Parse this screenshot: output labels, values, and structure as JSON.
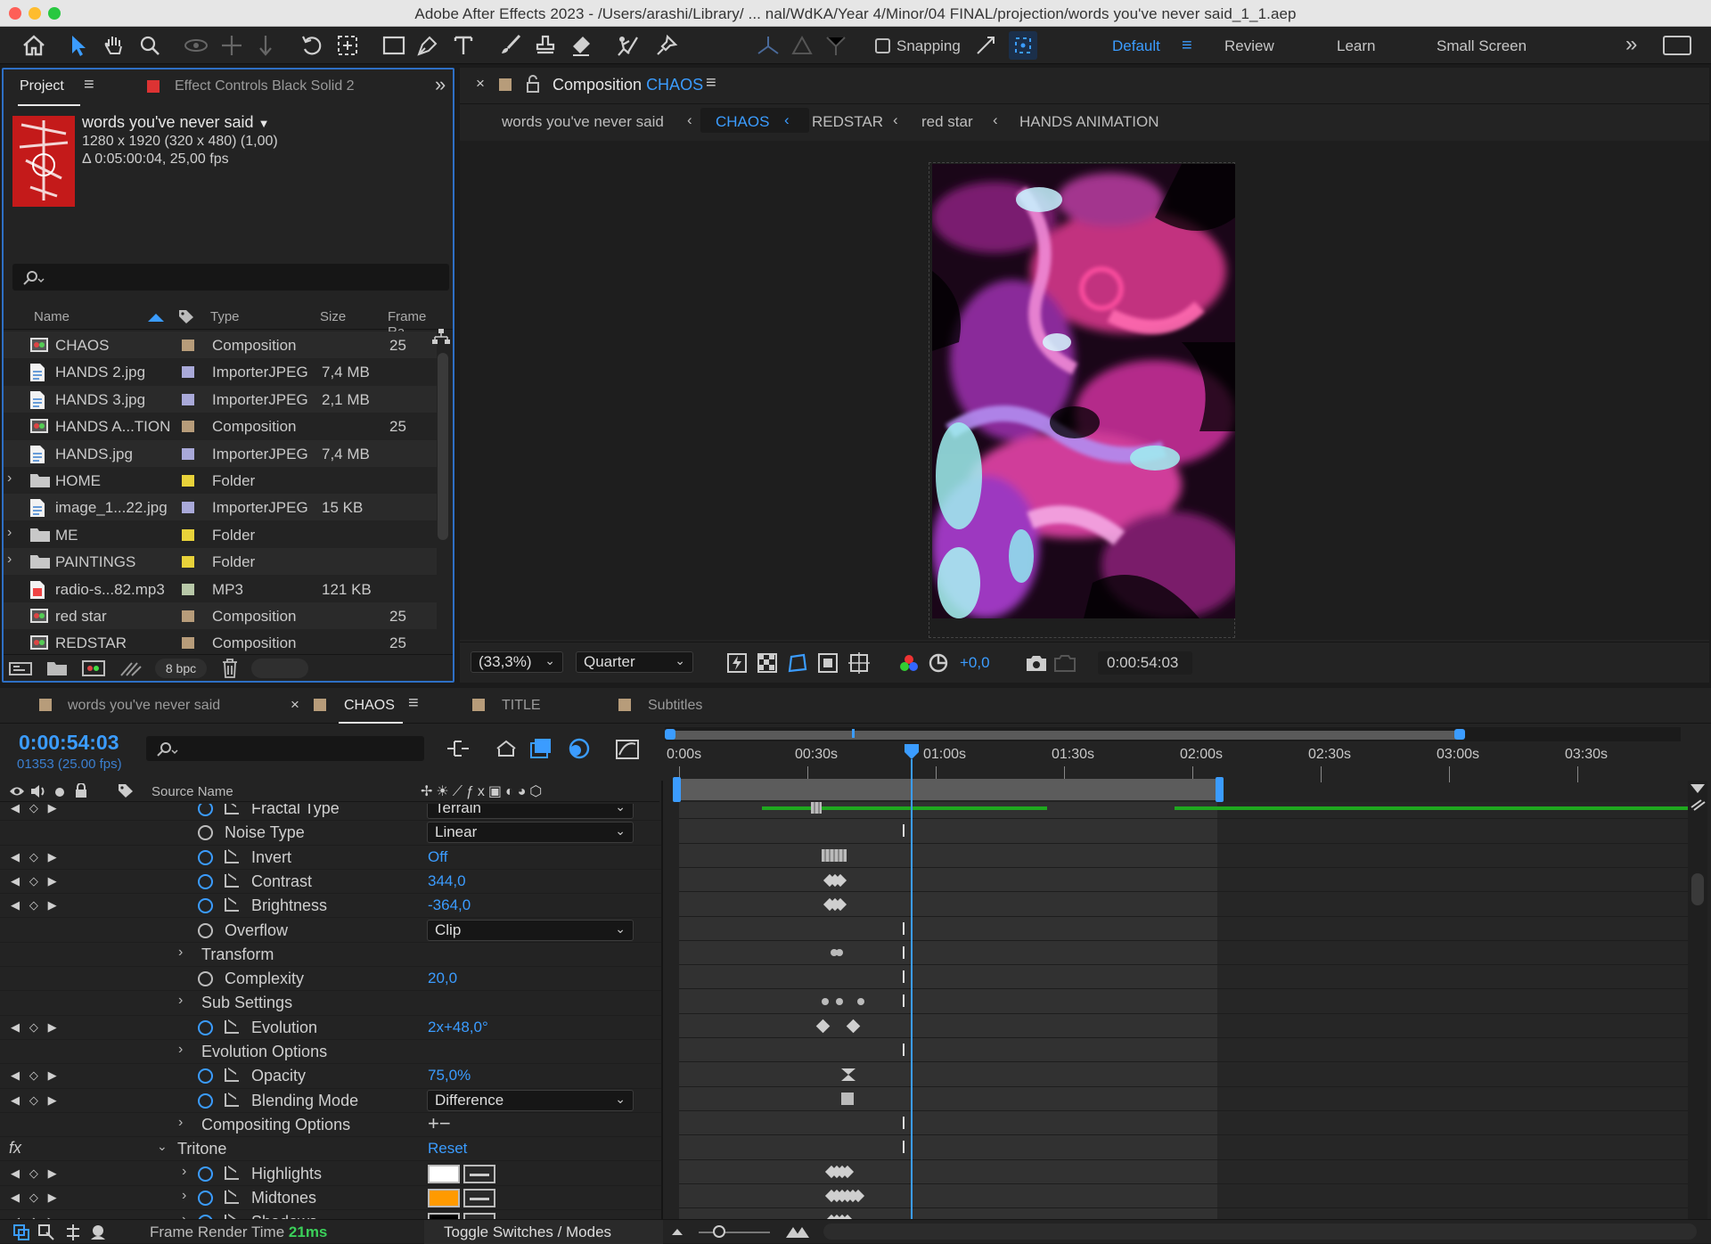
{
  "window": {
    "title": "Adobe After Effects 2023 - /Users/arashi/Library/ ... nal/WdKA/Year 4/Minor/04 FINAL/projection/words you've never said_1_1.aep"
  },
  "toolbar": {
    "snapping_label": "Snapping",
    "workspaces": [
      "Default",
      "Review",
      "Learn",
      "Small Screen"
    ]
  },
  "project_panel": {
    "tabs": [
      "Project",
      "Effect Controls Black Solid 2"
    ],
    "item_name": "words you've never said",
    "item_dims": "1280 x 1920  (320 x 480) (1,00)",
    "item_duration": "Δ 0:05:00:04, 25,00 fps",
    "columns": [
      "Name",
      "Type",
      "Size",
      "Frame Ra..."
    ],
    "items": [
      {
        "name": "CHAOS",
        "type": "Composition",
        "size": "",
        "fps": "25",
        "kind": "comp"
      },
      {
        "name": "HANDS 2.jpg",
        "type": "ImporterJPEG",
        "size": "7,4 MB",
        "fps": "",
        "kind": "file"
      },
      {
        "name": "HANDS 3.jpg",
        "type": "ImporterJPEG",
        "size": "2,1 MB",
        "fps": "",
        "kind": "file"
      },
      {
        "name": "HANDS A...TION",
        "type": "Composition",
        "size": "",
        "fps": "25",
        "kind": "comp"
      },
      {
        "name": "HANDS.jpg",
        "type": "ImporterJPEG",
        "size": "7,4 MB",
        "fps": "",
        "kind": "file"
      },
      {
        "name": "HOME",
        "type": "Folder",
        "size": "",
        "fps": "",
        "kind": "folder"
      },
      {
        "name": "image_1...22.jpg",
        "type": "ImporterJPEG",
        "size": "15 KB",
        "fps": "",
        "kind": "file"
      },
      {
        "name": "ME",
        "type": "Folder",
        "size": "",
        "fps": "",
        "kind": "folder"
      },
      {
        "name": "PAINTINGS",
        "type": "Folder",
        "size": "",
        "fps": "",
        "kind": "folder"
      },
      {
        "name": "radio-s...82.mp3",
        "type": "MP3",
        "size": "121 KB",
        "fps": "",
        "kind": "audio"
      },
      {
        "name": "red star",
        "type": "Composition",
        "size": "",
        "fps": "25",
        "kind": "comp"
      },
      {
        "name": "REDSTAR",
        "type": "Composition",
        "size": "",
        "fps": "25",
        "kind": "comp"
      }
    ],
    "bit_depth": "8 bpc"
  },
  "comp_panel": {
    "tab_prefix": "Composition",
    "tab_name": "CHAOS",
    "breadcrumbs": [
      "words you've never said",
      "CHAOS",
      "REDSTAR",
      "red star",
      "HANDS ANIMATION"
    ],
    "zoom": "(33,3%)",
    "resolution": "Quarter",
    "exposure": "+0,0",
    "timecode": "0:00:54:03"
  },
  "timeline": {
    "tabs": [
      "words you've never said",
      "CHAOS",
      "TITLE",
      "Subtitles"
    ],
    "timecode": "0:00:54:03",
    "frames": "01353 (25.00 fps)",
    "source_name_header": "Source Name",
    "ruler": [
      "0:00s",
      "00:30s",
      "01:00s",
      "01:30s",
      "02:00s",
      "02:30s",
      "03:00s",
      "03:30s"
    ],
    "properties": [
      {
        "name": "Fractal Type",
        "value": "Terrain",
        "control": "dropdown"
      },
      {
        "name": "Noise Type",
        "value": "Linear",
        "control": "dropdown"
      },
      {
        "name": "Invert",
        "value": "Off",
        "control": "value"
      },
      {
        "name": "Contrast",
        "value": "344,0",
        "control": "value"
      },
      {
        "name": "Brightness",
        "value": "-364,0",
        "control": "value"
      },
      {
        "name": "Overflow",
        "value": "Clip",
        "control": "dropdown"
      },
      {
        "name": "Transform",
        "value": "",
        "control": "group"
      },
      {
        "name": "Complexity",
        "value": "20,0",
        "control": "value"
      },
      {
        "name": "Sub Settings",
        "value": "",
        "control": "group"
      },
      {
        "name": "Evolution",
        "value": "2x+48,0°",
        "control": "value"
      },
      {
        "name": "Evolution Options",
        "value": "",
        "control": "group"
      },
      {
        "name": "Opacity",
        "value": "75,0%",
        "control": "value"
      },
      {
        "name": "Blending Mode",
        "value": "Difference",
        "control": "dropdown"
      },
      {
        "name": "Compositing Options",
        "value": "",
        "control": "group"
      },
      {
        "name": "Tritone",
        "value": "Reset",
        "control": "effect"
      },
      {
        "name": "Highlights",
        "value": "",
        "control": "color"
      },
      {
        "name": "Midtones",
        "value": "",
        "control": "color"
      },
      {
        "name": "Shadows",
        "value": "",
        "control": "color"
      }
    ],
    "footer": {
      "render_label": "Frame Render Time",
      "render_value": "21ms",
      "toggle": "Toggle Switches / Modes"
    }
  },
  "colors": {
    "accent": "#3b9cff",
    "highlight_swatch": "#ffffff",
    "midtone_swatch": "#ff9a00",
    "shadow_swatch": "#000000",
    "work_area": "#22b022"
  }
}
